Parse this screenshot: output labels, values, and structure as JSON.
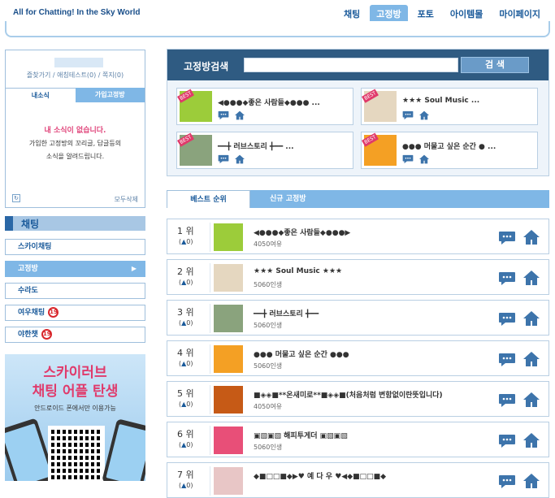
{
  "brand": "All for Chatting!  In the Sky World",
  "topnav": [
    {
      "label": "채팅",
      "active": false
    },
    {
      "label": "고정방",
      "active": true
    },
    {
      "label": "포토",
      "active": false
    },
    {
      "label": "아이템몰",
      "active": false
    },
    {
      "label": "마이페이지",
      "active": false
    }
  ],
  "profile": {
    "links": "즐찾가기 / 애칭테스트(0) / 쪽지(0)",
    "tab_news": "내소식",
    "tab_joined": "가입고정방",
    "no_news": "내 소식이 없습니다.",
    "message_line1": "가입한 고정방의 꼬리글, 답글등의",
    "message_line2": "소식을 알려드립니다.",
    "refresh_icon": "↻",
    "delete_all": "모두삭제"
  },
  "chat_menu": {
    "title": "채팅",
    "items": [
      {
        "label": "스카이채팅",
        "active": false,
        "badge": ""
      },
      {
        "label": "고정방",
        "active": true,
        "badge": ""
      },
      {
        "label": "수라도",
        "active": false,
        "badge": ""
      },
      {
        "label": "여우채팅",
        "active": false,
        "badge": "19"
      },
      {
        "label": "야한챗",
        "active": false,
        "badge": "19"
      }
    ],
    "active_arrow": "▶"
  },
  "banner": {
    "line1": "스카이러브",
    "line2": "채팅 어플 탄생",
    "line3": "안드로이드 폰에서만 이용가능"
  },
  "search": {
    "label": "고정방검색",
    "input_value": "",
    "button": "검 색"
  },
  "best": [
    {
      "title": "◀●●●◆좋은 사람들◆●●● ...",
      "ribbon": "BEST",
      "thumb_color": "#9ccc3a"
    },
    {
      "title": "★★★ Soul Music ...",
      "ribbon": "BEST",
      "thumb_color": "#e5d7c0"
    },
    {
      "title": "━━╋ 러브스토리 ╋━━ ...",
      "ribbon": "BEST",
      "thumb_color": "#8aa37d"
    },
    {
      "title": "●●● 머물고 싶은 순간 ● ...",
      "ribbon": "BEST",
      "thumb_color": "#f4a024"
    }
  ],
  "rank_tabs": {
    "best": "베스트 순위",
    "new": "신규 고정방"
  },
  "rankings": [
    {
      "rank": "1 위",
      "change_prefix": "(",
      "change_arrow": "▲",
      "change_value": "0",
      "change_suffix": ")",
      "title": "◀●●●◆좋은 사람들◆●●●▶",
      "count": "4050여유",
      "thumb_color": "#9ccc3a"
    },
    {
      "rank": "2 위",
      "change_prefix": "(",
      "change_arrow": "▲",
      "change_value": "0",
      "change_suffix": ")",
      "title": "★★★ Soul Music ★★★",
      "count": "5060인생",
      "thumb_color": "#e5d7c0"
    },
    {
      "rank": "3 위",
      "change_prefix": "(",
      "change_arrow": "▲",
      "change_value": "0",
      "change_suffix": ")",
      "title": "━━╋ 러브스토리 ╋━━",
      "count": "5060인생",
      "thumb_color": "#8aa37d"
    },
    {
      "rank": "4 위",
      "change_prefix": "(",
      "change_arrow": "▲",
      "change_value": "0",
      "change_suffix": ")",
      "title": "●●● 머물고 싶은 순간 ●●●",
      "count": "5060인생",
      "thumb_color": "#f4a024"
    },
    {
      "rank": "5 위",
      "change_prefix": "(",
      "change_arrow": "▲",
      "change_value": "0",
      "change_suffix": ")",
      "title": "■◈◈■**온새미로**■◈◈■(처음처럼 변함없이란뜻입니다)",
      "count": "4050여유",
      "thumb_color": "#c65a16"
    },
    {
      "rank": "6 위",
      "change_prefix": "(",
      "change_arrow": "▲",
      "change_value": "0",
      "change_suffix": ")",
      "title": "▣▧▣▧ 해피투게더 ▣▧▣▧",
      "count": "5060인생",
      "thumb_color": "#e84f78"
    },
    {
      "rank": "7 위",
      "change_prefix": "(",
      "change_arrow": "▲",
      "change_value": "0",
      "change_suffix": ")",
      "title": "◆■□□■◆▶♥ 예 다 우 ♥◀◆■□□■◆",
      "count": "",
      "thumb_color": "#e8c6c6"
    }
  ],
  "colors": {
    "accent": "#7fb7e6",
    "dark": "#2f5b82",
    "pink": "#e03a6b",
    "icon": "#3d74ab"
  }
}
